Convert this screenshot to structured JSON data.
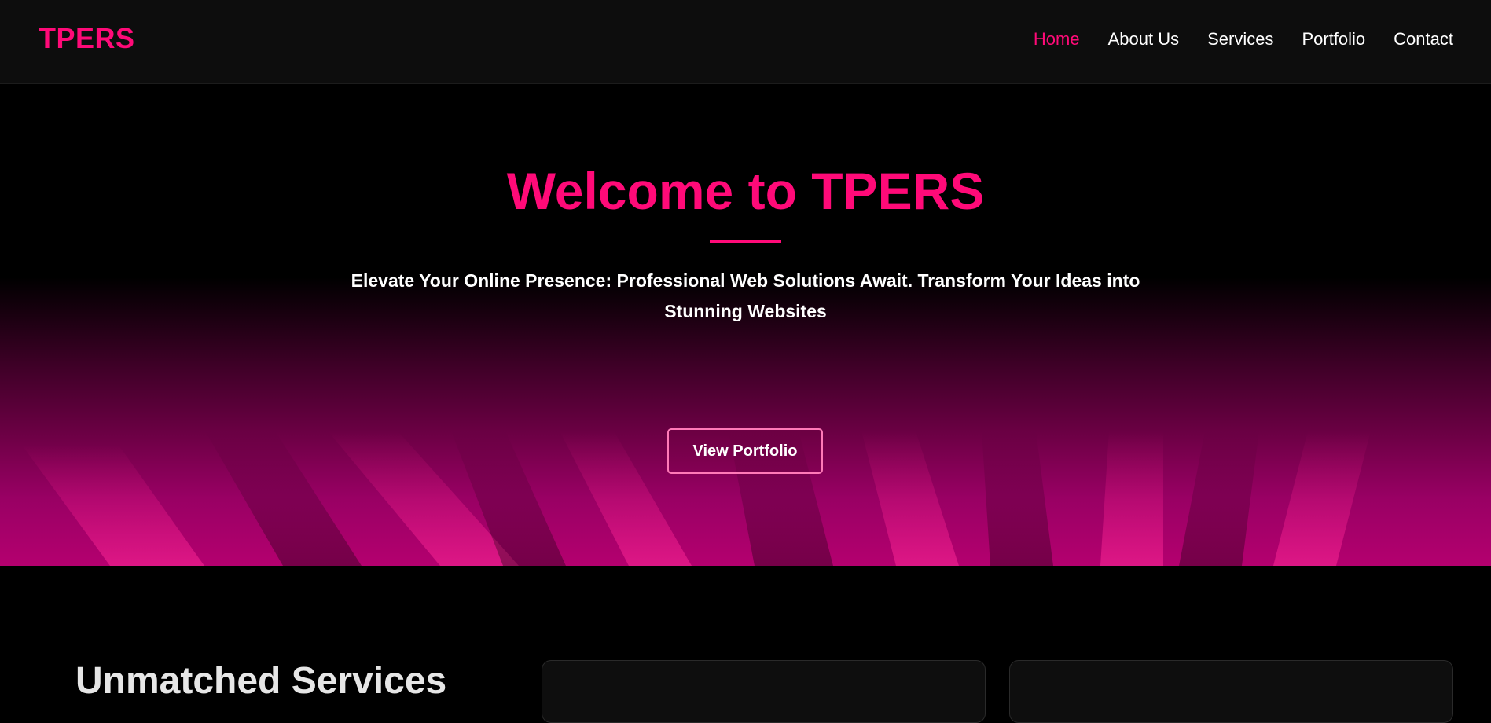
{
  "header": {
    "logo": "TPERS",
    "nav": [
      {
        "label": "Home",
        "active": true
      },
      {
        "label": "About Us",
        "active": false
      },
      {
        "label": "Services",
        "active": false
      },
      {
        "label": "Portfolio",
        "active": false
      },
      {
        "label": "Contact",
        "active": false
      }
    ]
  },
  "hero": {
    "title": "Welcome to TPERS",
    "subtitle": "Elevate Your Online Presence: Professional Web Solutions Await. Transform Your Ideas into Stunning Websites",
    "button_label": "View Portfolio"
  },
  "services": {
    "heading": "Unmatched Services"
  },
  "colors": {
    "accent": "#ff0a78",
    "background": "#000000",
    "header_bg": "#0d0d0d",
    "text": "#ffffff"
  }
}
